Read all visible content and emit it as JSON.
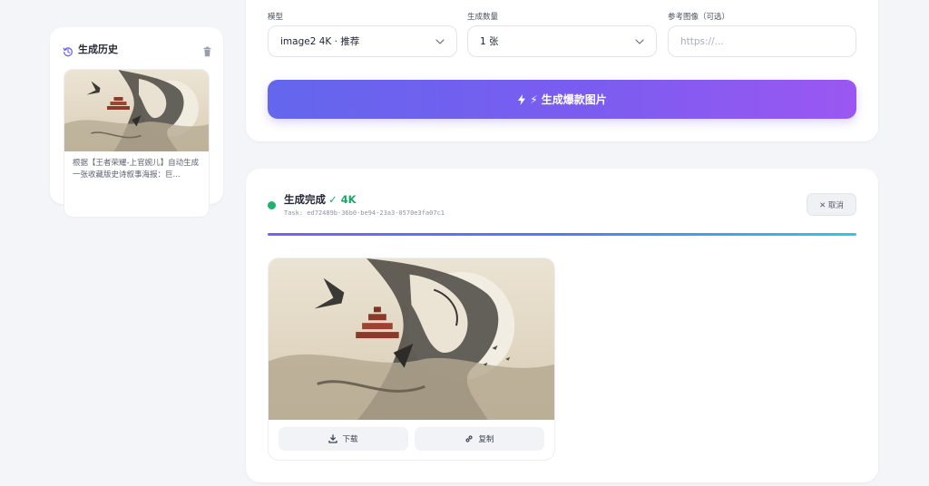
{
  "sidebar": {
    "title": "生成历史",
    "history": [
      {
        "text": "根据【王者荣耀-上官婉儿】自动生成一张收藏版史诗叙事海报：巨..."
      }
    ]
  },
  "form": {
    "model_label": "模型",
    "model_value": "image2 4K · 推荐",
    "count_label": "生成数量",
    "count_value": "1 张",
    "ref_label": "参考图像（可选）",
    "ref_placeholder": "https://...",
    "generate_label": "⚡ 生成爆款图片"
  },
  "result": {
    "status": "生成完成",
    "status_suffix": "✓ 4K",
    "task_id": "Task: ed72489b-36b0-be94-23a3-0570e3fa07c1",
    "cancel_label": "✕ 取消",
    "progress": 1.0,
    "download_label": "下载",
    "copy_label": "复制"
  },
  "colors": {
    "accent_start": "#6366ee",
    "accent_end": "#9b57f2",
    "success": "#20b26b"
  },
  "icons": [
    "history-icon",
    "trash-icon",
    "chevron-down-icon",
    "bolt-icon",
    "download-icon",
    "link-icon"
  ]
}
